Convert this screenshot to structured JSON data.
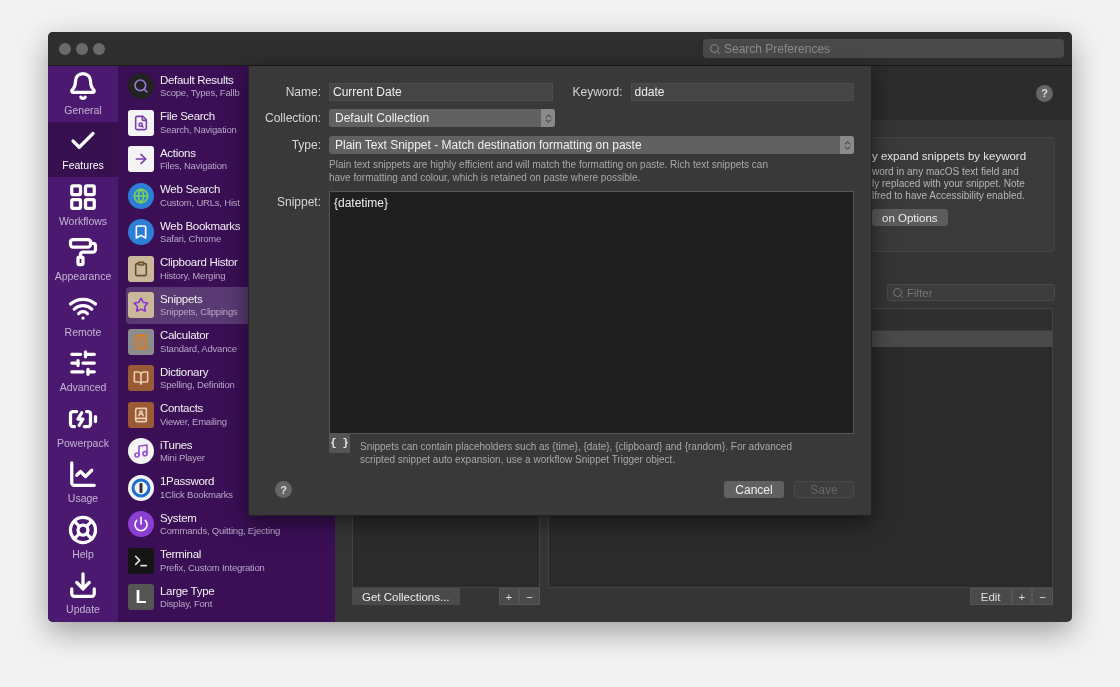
{
  "window": {
    "search_placeholder": "Search Preferences"
  },
  "nav": [
    {
      "label": "General",
      "selected": false
    },
    {
      "label": "Features",
      "selected": true
    },
    {
      "label": "Workflows",
      "selected": false
    },
    {
      "label": "Appearance",
      "selected": false
    },
    {
      "label": "Remote",
      "selected": false
    },
    {
      "label": "Advanced",
      "selected": false
    },
    {
      "label": "Powerpack",
      "selected": false
    },
    {
      "label": "Usage",
      "selected": false
    },
    {
      "label": "Help",
      "selected": false
    },
    {
      "label": "Update",
      "selected": false
    }
  ],
  "features": [
    {
      "title": "Default Results",
      "subtitle": "Scope, Types, Fallb",
      "selected": false
    },
    {
      "title": "File Search",
      "subtitle": "Search, Navigation",
      "selected": false
    },
    {
      "title": "Actions",
      "subtitle": "Files, Navigation",
      "selected": false
    },
    {
      "title": "Web Search",
      "subtitle": "Custom, URLs, Hist",
      "selected": false
    },
    {
      "title": "Web Bookmarks",
      "subtitle": "Safari, Chrome",
      "selected": false
    },
    {
      "title": "Clipboard Histor",
      "subtitle": "History, Merging",
      "selected": false
    },
    {
      "title": "Snippets",
      "subtitle": "Snippets, Clippings",
      "selected": true
    },
    {
      "title": "Calculator",
      "subtitle": "Standard, Advance",
      "selected": false
    },
    {
      "title": "Dictionary",
      "subtitle": "Spelling, Definition",
      "selected": false
    },
    {
      "title": "Contacts",
      "subtitle": "Viewer, Emailing",
      "selected": false
    },
    {
      "title": "iTunes",
      "subtitle": "Mini Player",
      "selected": false
    },
    {
      "title": "1Password",
      "subtitle": "1Click Bookmarks",
      "selected": false
    },
    {
      "title": "System",
      "subtitle": "Commands, Quitting, Ejecting",
      "selected": false
    },
    {
      "title": "Terminal",
      "subtitle": "Prefix, Custom Integration",
      "selected": false
    },
    {
      "title": "Large Type",
      "subtitle": "Display, Font",
      "selected": false,
      "glyph": "L"
    }
  ],
  "background": {
    "help_button": "?",
    "card_title": "y expand snippets by keyword",
    "card_lines": [
      "word in any macOS text field and",
      "ly replaced with your snippet. Note",
      "lfred to have Accessibility enabled."
    ],
    "card_button": "on Options",
    "filter_placeholder": "Filter",
    "collections_button": "Get Collections...",
    "add": "+",
    "remove": "−",
    "edit": "Edit"
  },
  "sheet": {
    "name_label": "Name:",
    "name_value": "Current Date",
    "keyword_label": "Keyword:",
    "keyword_value": "ddate",
    "collection_label": "Collection:",
    "collection_value": "Default Collection",
    "type_label": "Type:",
    "type_value": "Plain Text Snippet - Match destination formatting on paste",
    "type_help": "Plain text snippets are highly efficient and will match the formatting on paste. Rich text snippets can have formatting and colour, which is retained on paste where possible.",
    "snippet_label": "Snippet:",
    "snippet_value": "{datetime}",
    "placeholder_button": "{ }",
    "placeholder_help": "Snippets can contain placeholders such as {time}, {date}, {clipboard} and {random}. For advanced scripted snippet auto expansion, use a workflow Snippet Trigger object.",
    "help_button": "?",
    "cancel": "Cancel",
    "save": {
      "label": "Save",
      "disabled": true
    }
  }
}
